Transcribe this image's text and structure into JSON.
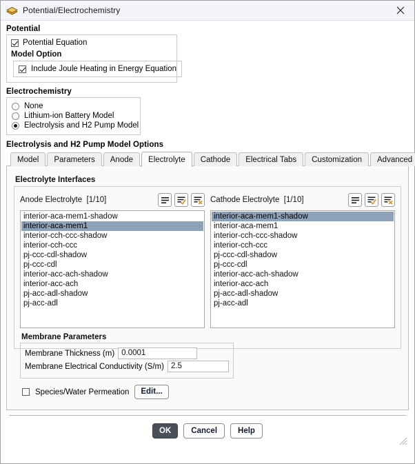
{
  "window": {
    "title": "Potential/Electrochemistry",
    "icon": "fluent-mesh-icon",
    "close_label": "close-icon"
  },
  "potential": {
    "group_label": "Potential",
    "equation_checkbox": {
      "label": "Potential Equation",
      "checked": true
    },
    "model_option_label": "Model Option",
    "joule_checkbox": {
      "label": "Include Joule Heating in Energy Equation",
      "checked": true
    }
  },
  "electrochemistry": {
    "group_label": "Electrochemistry",
    "options": [
      {
        "label": "None",
        "selected": false
      },
      {
        "label": "Lithium-ion Battery Model",
        "selected": false
      },
      {
        "label": "Electrolysis and H2 Pump Model",
        "selected": true
      }
    ]
  },
  "options_section": {
    "title": "Electrolysis and H2 Pump Model Options",
    "tabs": [
      {
        "label": "Model",
        "active": false
      },
      {
        "label": "Parameters",
        "active": false
      },
      {
        "label": "Anode",
        "active": false
      },
      {
        "label": "Electrolyte",
        "active": true
      },
      {
        "label": "Cathode",
        "active": false
      },
      {
        "label": "Electrical Tabs",
        "active": false
      },
      {
        "label": "Customization",
        "active": false
      },
      {
        "label": "Advanced",
        "active": false
      }
    ]
  },
  "electrolyte_interfaces": {
    "section_title": "Electrolyte Interfaces",
    "toolbar_icons": [
      "list-icon",
      "list-select-all-icon",
      "list-deselect-all-icon"
    ],
    "anode": {
      "label": "Anode Electrolyte",
      "count": "[1/10]",
      "items": [
        {
          "name": "interior-aca-mem1-shadow",
          "selected": false
        },
        {
          "name": "interior-aca-mem1",
          "selected": true
        },
        {
          "name": "interior-cch-ccc-shadow",
          "selected": false
        },
        {
          "name": "interior-cch-ccc",
          "selected": false
        },
        {
          "name": "pj-ccc-cdl-shadow",
          "selected": false
        },
        {
          "name": "pj-ccc-cdl",
          "selected": false
        },
        {
          "name": "interior-acc-ach-shadow",
          "selected": false
        },
        {
          "name": "interior-acc-ach",
          "selected": false
        },
        {
          "name": "pj-acc-adl-shadow",
          "selected": false
        },
        {
          "name": "pj-acc-adl",
          "selected": false
        }
      ]
    },
    "cathode": {
      "label": "Cathode Electrolyte",
      "count": "[1/10]",
      "items": [
        {
          "name": "interior-aca-mem1-shadow",
          "selected": true
        },
        {
          "name": "interior-aca-mem1",
          "selected": false
        },
        {
          "name": "interior-cch-ccc-shadow",
          "selected": false
        },
        {
          "name": "interior-cch-ccc",
          "selected": false
        },
        {
          "name": "pj-ccc-cdl-shadow",
          "selected": false
        },
        {
          "name": "pj-ccc-cdl",
          "selected": false
        },
        {
          "name": "interior-acc-ach-shadow",
          "selected": false
        },
        {
          "name": "interior-acc-ach",
          "selected": false
        },
        {
          "name": "pj-acc-adl-shadow",
          "selected": false
        },
        {
          "name": "pj-acc-adl",
          "selected": false
        }
      ]
    }
  },
  "membrane_parameters": {
    "section_title": "Membrane Parameters",
    "thickness": {
      "label": "Membrane Thickness (m)",
      "value": "0.0001"
    },
    "conductivity": {
      "label": "Membrane Electrical Conductivity (S/m)",
      "value": "2.5"
    },
    "permeation": {
      "label": "Species/Water Permeation",
      "checked": false
    },
    "edit_button": "Edit..."
  },
  "footer": {
    "ok": "OK",
    "cancel": "Cancel",
    "help": "Help"
  },
  "colors": {
    "selection": "#8da2b8",
    "accent_orange": "#d98b12",
    "ok_button": "#4a4f5c"
  }
}
